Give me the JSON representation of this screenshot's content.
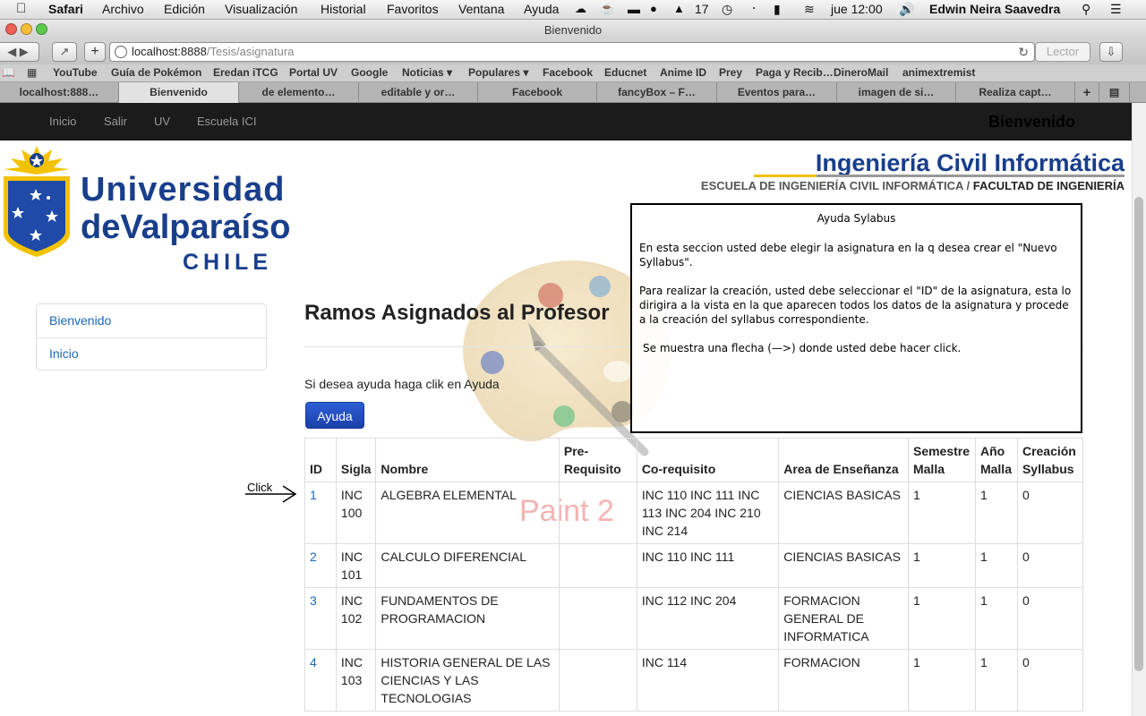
{
  "menubar": {
    "apple": "",
    "app": "Safari",
    "menus": [
      "Archivo",
      "Edición",
      "Visualización",
      "Historial",
      "Favoritos",
      "Ventana",
      "Ayuda"
    ],
    "status_count": "17",
    "clock": "jue 12:00",
    "user": "Edwin Neira Saavedra"
  },
  "window": {
    "title": "Bienvenido"
  },
  "toolbar": {
    "url_host": "localhost:8888",
    "url_path": "/Tesis/asignatura",
    "reader_label": "Lector"
  },
  "bookmarks": [
    "YouTube",
    "Guía de Pokémon",
    "Eredan iTCG",
    "Portal UV",
    "Google",
    "Noticias ▾",
    "Populares ▾",
    "Facebook",
    "Educnet",
    "Anime ID",
    "Prey",
    "Paga y Recib…",
    "DineroMail",
    "animextremist"
  ],
  "tabs": [
    "localhost:888…",
    "Bienvenido",
    "de elemento…",
    "editable y or…",
    "Facebook",
    "fancyBox – F…",
    "Eventos para…",
    "imagen de si…",
    "Realiza capt…"
  ],
  "navbar": {
    "links": [
      "Inicio",
      "Salir",
      "UV",
      "Escuela ICI"
    ],
    "brand": "Bienvenido"
  },
  "logo": {
    "line1": "Universidad",
    "line2": "deValparaíso",
    "line3": "CHILE"
  },
  "ici": {
    "title": "Ingeniería Civil Informática",
    "sub_a": "ESCUELA DE INGENIERÍA CIVIL INFORMÁTICA /",
    "sub_b": "FACULTAD DE INGENIERÍA"
  },
  "watermark_text": "Paint 2",
  "sidenav": [
    "Bienvenido",
    "Inicio"
  ],
  "main": {
    "heading": "Ramos Asignados al Profesor",
    "help_text": "Si desea ayuda haga clik en Ayuda",
    "help_button": "Ayuda"
  },
  "helpbox": {
    "title": "Ayuda Sylabus",
    "p1": "En esta seccion usted debe elegir la asignatura en la q desea crear el \"Nuevo Syllabus\".",
    "p2": "Para realizar la creación, usted debe seleccionar el \"ID\" de la asignatura, esta lo dirigira a la vista en la que aparecen todos los datos de la asignatura y procede a la creación del syllabus correspondiente.",
    "p3": "Se muestra una flecha (—>) donde usted debe hacer click."
  },
  "annotation": {
    "click_label": "Click"
  },
  "table": {
    "headers": [
      "ID",
      "Sigla",
      "Nombre",
      "Pre-\nRequisito",
      "Co-requisito",
      "Area de Enseñanza",
      "Semestre Malla",
      "Año Malla",
      "Creación Syllabus"
    ],
    "rows": [
      [
        "1",
        "INC 100",
        "ALGEBRA ELEMENTAL",
        "",
        "INC 110 INC 111 INC 113 INC 204 INC 210 INC 214",
        "CIENCIAS BASICAS",
        "1",
        "1",
        "0"
      ],
      [
        "2",
        "INC 101",
        "CALCULO DIFERENCIAL",
        "",
        "INC 110 INC 111",
        "CIENCIAS BASICAS",
        "1",
        "1",
        "0"
      ],
      [
        "3",
        "INC 102",
        "FUNDAMENTOS DE PROGRAMACION",
        "",
        "INC 112 INC 204",
        "FORMACION GENERAL DE INFORMATICA",
        "1",
        "1",
        "0"
      ],
      [
        "4",
        "INC 103",
        "HISTORIA GENERAL DE LAS CIENCIAS Y LAS TECNOLOGIAS",
        "",
        "INC 114",
        "FORMACION",
        "1",
        "1",
        "0"
      ]
    ]
  },
  "colors": {
    "uv_blue": "#183e8c",
    "link_blue": "#1a68b8",
    "button_blue": "#1a3fa8",
    "navbar": "#1b1b1b",
    "accent_yellow": "#f2c200"
  }
}
